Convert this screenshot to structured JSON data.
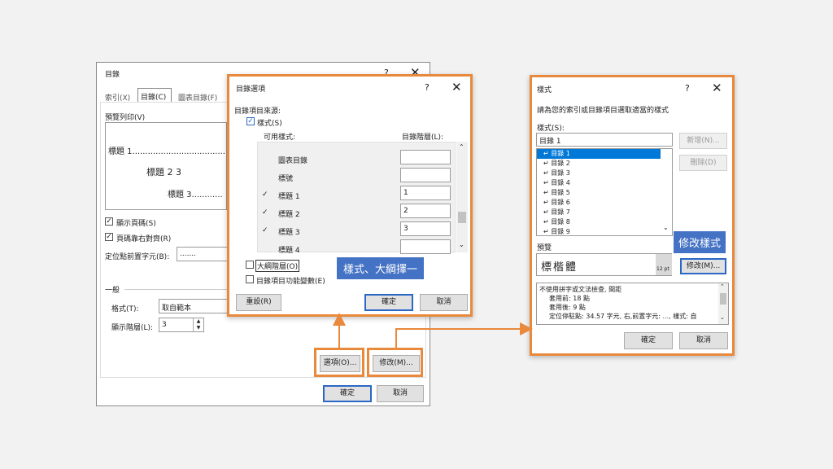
{
  "toc_dialog": {
    "title": "目錄",
    "help": "?",
    "close": "✕",
    "tabs": [
      "索引(X)",
      "目錄(C)",
      "圖表目錄(F)"
    ],
    "print_preview_label": "預覽列印(V)",
    "preview_lines": [
      "標題 1......................................",
      "標題 2 3",
      "標題 3............"
    ],
    "show_page_numbers": "顯示頁碼(S)",
    "right_align": "頁碼靠右對齊(R)",
    "tab_leader_label": "定位點前置字元(B):",
    "tab_leader_value": ".......",
    "general_label": "一般",
    "format_label": "格式(T):",
    "format_value": "取自範本",
    "levels_label": "顯示階層(L):",
    "levels_value": "3",
    "options_button": "選項(O)...",
    "modify_button": "修改(M)...",
    "ok_button": "確定",
    "cancel_button": "取消"
  },
  "options_dialog": {
    "title": "目錄選項",
    "help": "?",
    "close": "✕",
    "source_label": "目錄項目來源:",
    "styles_check": "樣式(S)",
    "available_styles_header": "可用樣式:",
    "level_header": "目錄階層(L):",
    "rows": [
      {
        "name": "圖表目錄",
        "checked": false,
        "level": ""
      },
      {
        "name": "標號",
        "checked": false,
        "level": ""
      },
      {
        "name": "標題 1",
        "checked": true,
        "level": "1"
      },
      {
        "name": "標題 2",
        "checked": true,
        "level": "2"
      },
      {
        "name": "標題 3",
        "checked": true,
        "level": "3"
      },
      {
        "name": "標題 4",
        "checked": false,
        "level": ""
      }
    ],
    "outline_check": "大綱階層(O)",
    "field_check": "目錄項目功能變數(E)",
    "reset_button": "重設(R)",
    "ok_button": "確定",
    "cancel_button": "取消"
  },
  "style_dialog": {
    "title": "樣式",
    "help": "?",
    "close": "✕",
    "instruction": "請為您的索引或目錄項目選取適當的樣式",
    "styles_label": "樣式(S):",
    "style_input": "目錄 1",
    "style_list": [
      "目錄 1",
      "目錄 2",
      "目錄 3",
      "目錄 4",
      "目錄 5",
      "目錄 6",
      "目錄 7",
      "目錄 8",
      "目錄 9"
    ],
    "new_button": "新增(N)...",
    "delete_button": "刪除(D)",
    "preview_label": "預覽",
    "preview_text": "標楷體",
    "preview_size": "12 pt",
    "modify_button": "修改(M)...",
    "description_lines": [
      "不使用拼字或文法檢查, 間距",
      "套用前:  18 點",
      "套用後:  9 點",
      "定位停駐點:  34.57 字元, 右,前置字元: ..., 樣式: 自"
    ],
    "ok_button": "確定",
    "cancel_button": "取消"
  },
  "annotations": {
    "styles_outline_tag": "樣式、大綱擇一",
    "modify_style_tag": "修改樣式"
  },
  "colors": {
    "accent_orange": "#e8893c",
    "tag_blue": "#4472c4",
    "selection_blue": "#0078d7"
  }
}
